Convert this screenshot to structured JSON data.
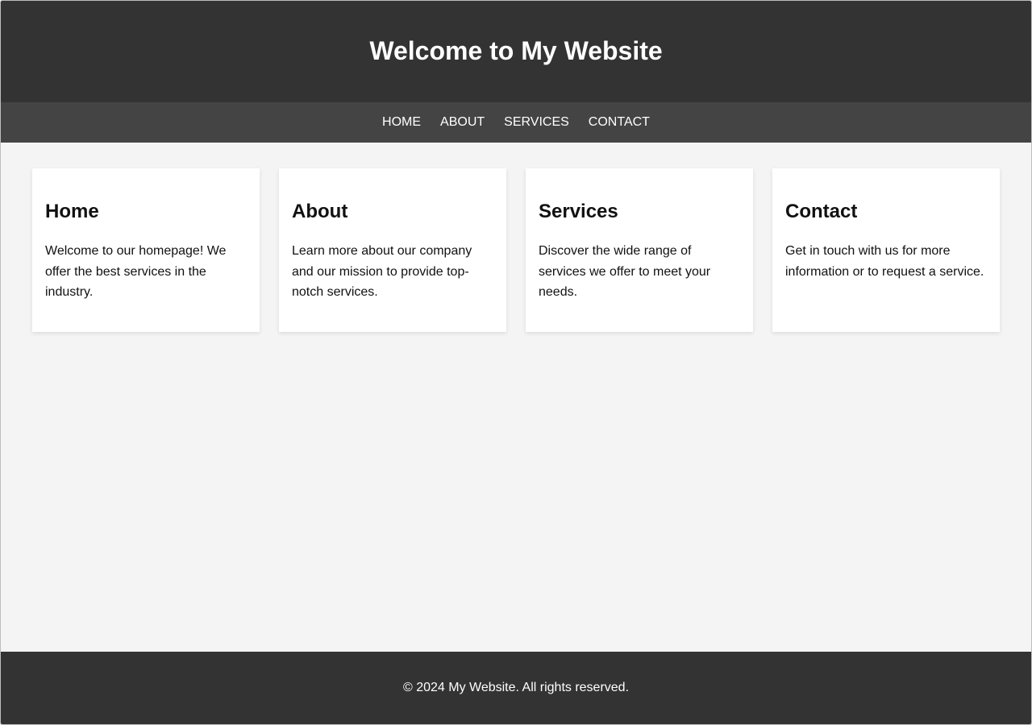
{
  "header": {
    "title": "Welcome to My Website"
  },
  "nav": {
    "items": [
      {
        "label": "HOME"
      },
      {
        "label": "ABOUT"
      },
      {
        "label": "SERVICES"
      },
      {
        "label": "CONTACT"
      }
    ]
  },
  "cards": [
    {
      "title": "Home",
      "text": "Welcome to our homepage! We offer the best services in the industry."
    },
    {
      "title": "About",
      "text": "Learn more about our company and our mission to provide top-notch services."
    },
    {
      "title": "Services",
      "text": "Discover the wide range of services we offer to meet your needs."
    },
    {
      "title": "Contact",
      "text": "Get in touch with us for more information or to request a service."
    }
  ],
  "footer": {
    "text": "© 2024 My Website. All rights reserved."
  },
  "colors": {
    "header_bg": "#333333",
    "nav_bg": "#444444",
    "page_bg": "#f4f4f4",
    "card_bg": "#ffffff",
    "footer_bg": "#333333"
  }
}
